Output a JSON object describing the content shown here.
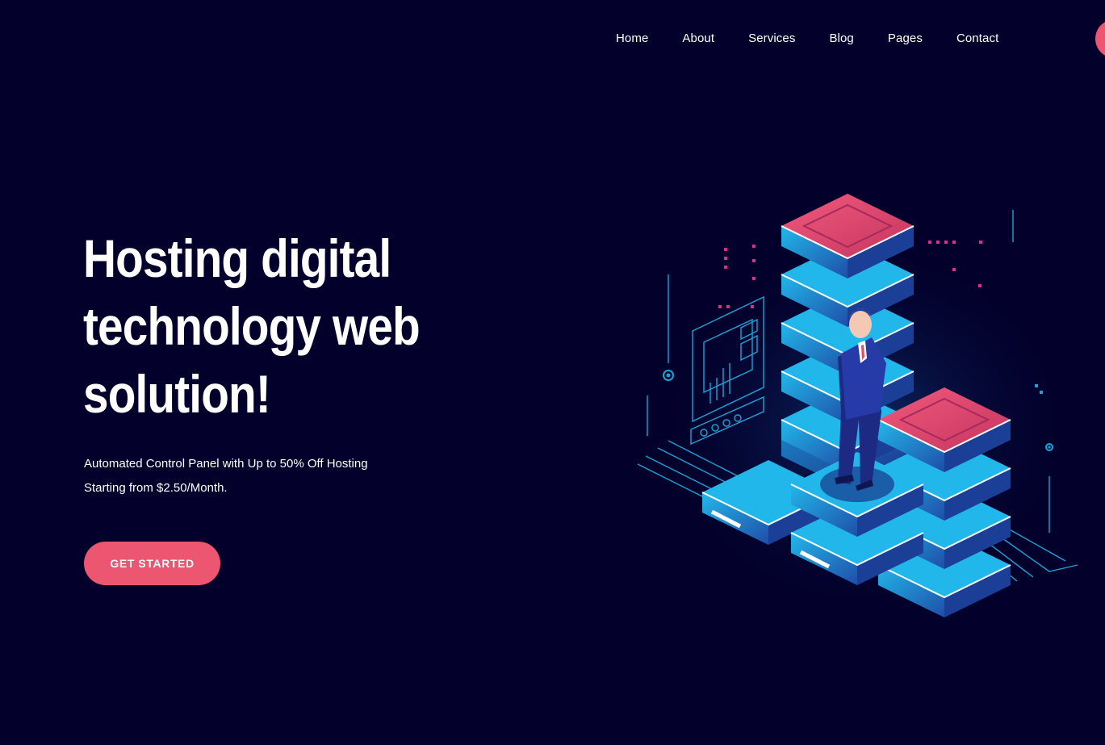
{
  "nav": {
    "items": [
      {
        "label": "Home"
      },
      {
        "label": "About"
      },
      {
        "label": "Services"
      },
      {
        "label": "Blog"
      },
      {
        "label": "Pages"
      },
      {
        "label": "Contact"
      }
    ]
  },
  "hero": {
    "title_line1": "Hosting digital",
    "title_line2": "technology web",
    "title_line3": "solution!",
    "subtitle_line1": "Automated Control Panel with Up to 50% Off Hosting",
    "subtitle_line2": "Starting from $2.50/Month.",
    "cta_label": "GET STARTED"
  },
  "colors": {
    "background": "#03012c",
    "accent": "#ec5670",
    "server_blue": "#1aa3d8",
    "server_top": "#e24a6c"
  },
  "illustration": {
    "icon": "isometric-server-stack-illustration"
  }
}
